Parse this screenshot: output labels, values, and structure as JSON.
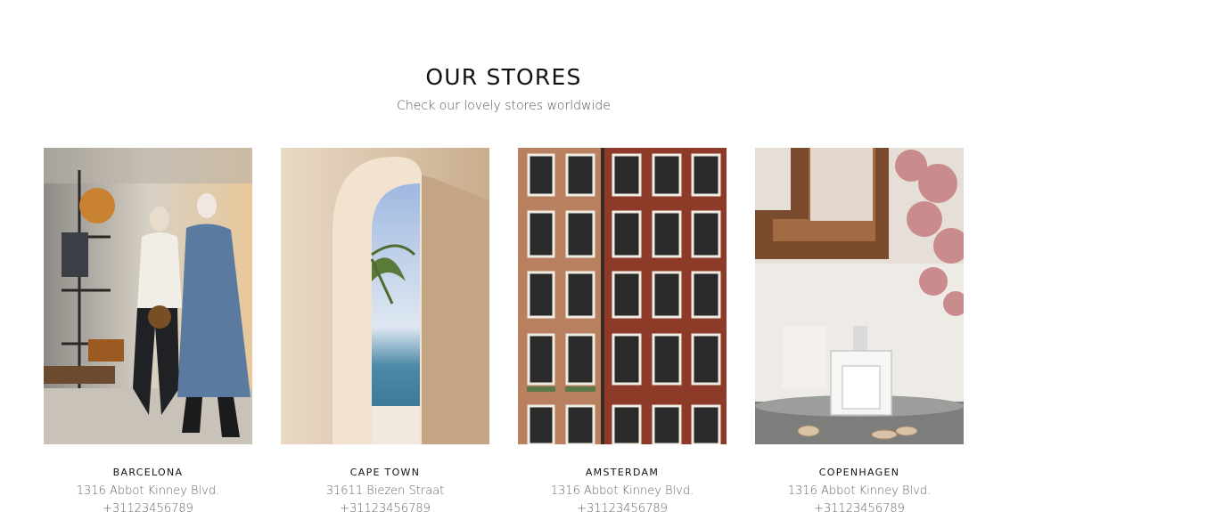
{
  "section": {
    "title": "OUR STORES",
    "subtitle": "Check our lovely stores worldwide"
  },
  "stores": [
    {
      "name": "BARCELONA",
      "address": "1316 Abbot Kinney Blvd.",
      "phone": "+31123456789",
      "image": "boutique-window-mannequins-photo"
    },
    {
      "name": "CAPE TOWN",
      "address": "31611 Biezen Straat",
      "phone": "+31123456789",
      "image": "arched-doorway-sea-view-photo"
    },
    {
      "name": "AMSTERDAM",
      "address": "1316 Abbot Kinney Blvd.",
      "phone": "+31123456789",
      "image": "canal-house-facade-photo"
    },
    {
      "name": "COPENHAGEN",
      "address": "1316 Abbot Kinney Blvd.",
      "phone": "+31123456789",
      "image": "perfume-bottle-tray-photo"
    }
  ],
  "colors": {
    "title": "#111111",
    "text": "#666666",
    "background": "#ffffff"
  }
}
